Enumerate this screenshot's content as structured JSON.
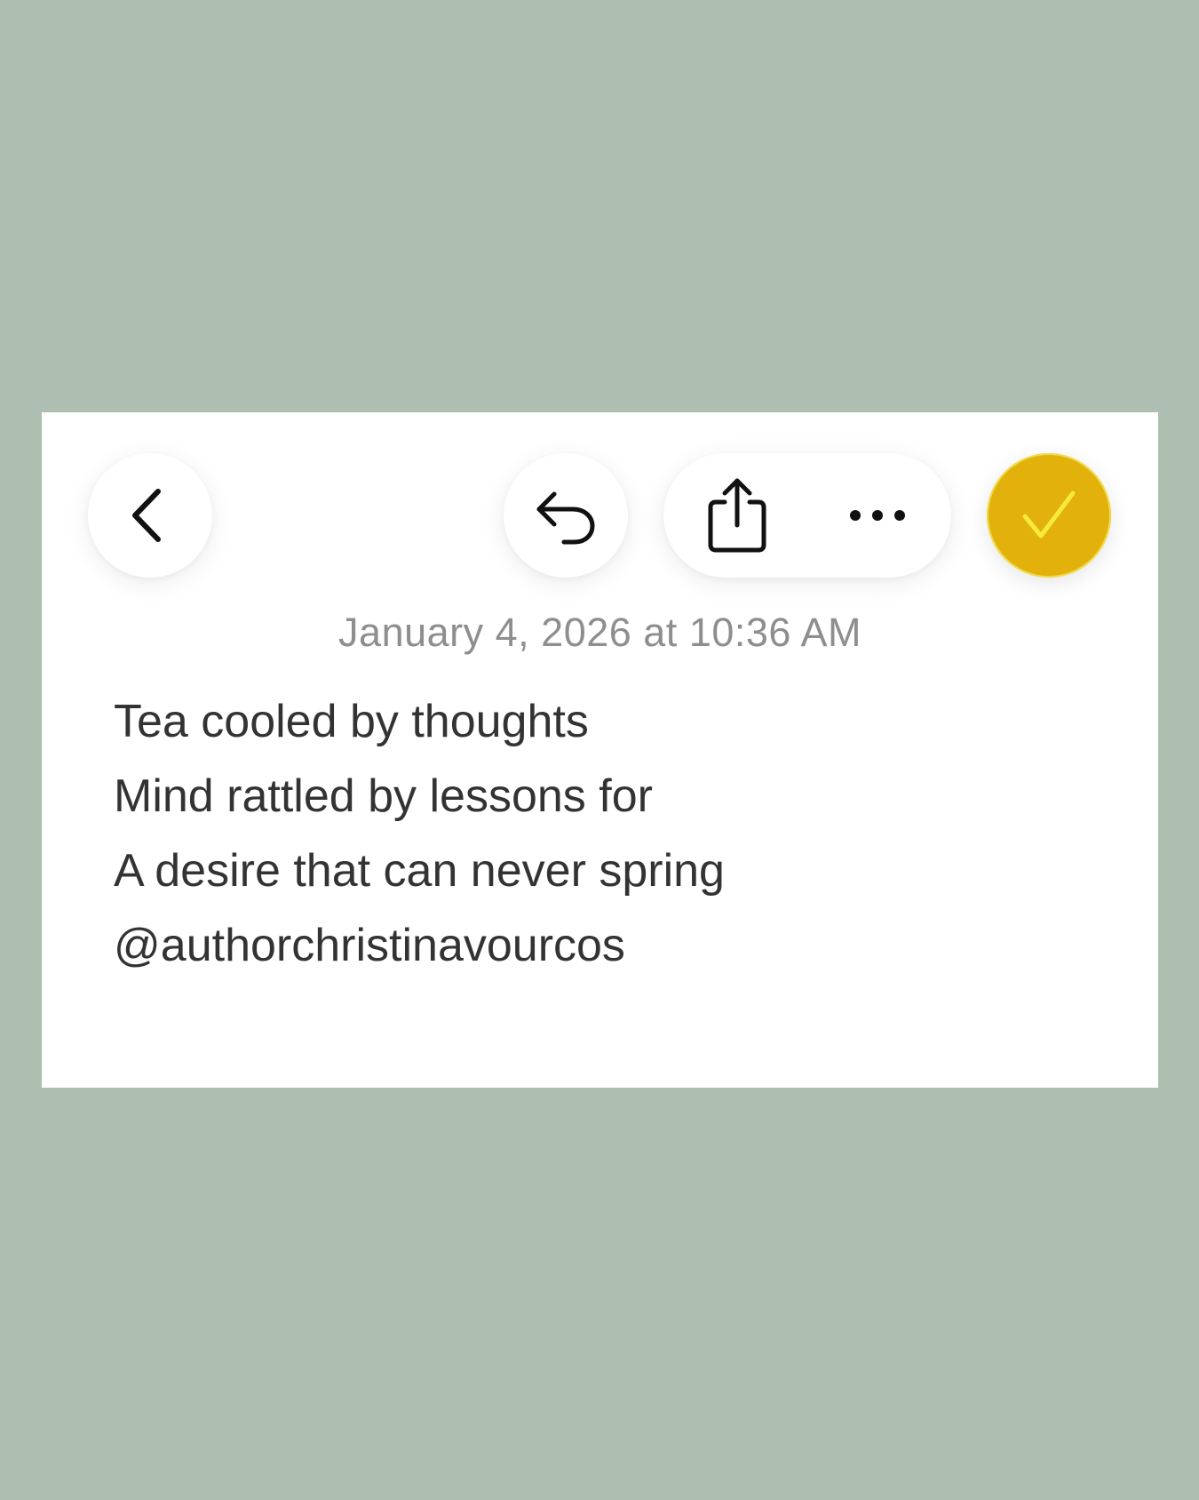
{
  "toolbar": {
    "back_icon": "chevron-left-icon",
    "undo_icon": "undo-arrow-icon",
    "share_icon": "share-icon",
    "more_icon": "ellipsis-icon",
    "done_icon": "checkmark-icon",
    "done_color": "#e2b10c",
    "done_check_color": "#f7ea3c"
  },
  "note": {
    "timestamp": "January 4, 2026 at 10:36 AM",
    "lines": [
      "Tea cooled by thoughts",
      "Mind rattled by lessons for",
      "A desire that can never spring",
      "@authorchristinavourcos"
    ]
  },
  "colors": {
    "background": "#adbfb0",
    "card": "#ffffff",
    "text": "#333333",
    "timestamp": "#8e8e8e"
  }
}
